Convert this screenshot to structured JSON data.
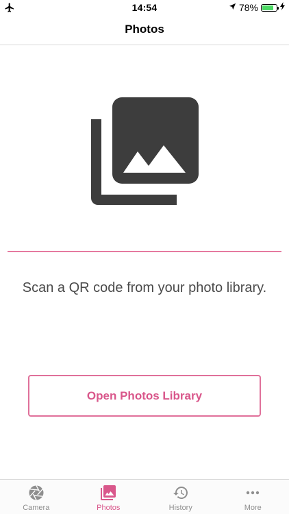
{
  "status_bar": {
    "time": "14:54",
    "battery_percent": "78%",
    "battery_level": 0.78,
    "icons": [
      "airplane-icon",
      "location-arrow-icon",
      "battery-icon",
      "charging-bolt-icon"
    ]
  },
  "nav": {
    "title": "Photos"
  },
  "main": {
    "hero_icon": "photo-library-icon",
    "instruction": "Scan a QR code from your photo library.",
    "open_button_label": "Open Photos Library"
  },
  "tab_bar": {
    "tabs": [
      {
        "label": "Camera",
        "icon": "camera-aperture-icon",
        "active": false
      },
      {
        "label": "Photos",
        "icon": "photos-icon",
        "active": true
      },
      {
        "label": "History",
        "icon": "history-icon",
        "active": false
      },
      {
        "label": "More",
        "icon": "more-dots-icon",
        "active": false
      }
    ]
  },
  "colors": {
    "accent": "#d9578b",
    "divider": "#e57aa0",
    "icon_dark": "#3d3d3d",
    "tab_inactive": "#8e8e8e"
  }
}
